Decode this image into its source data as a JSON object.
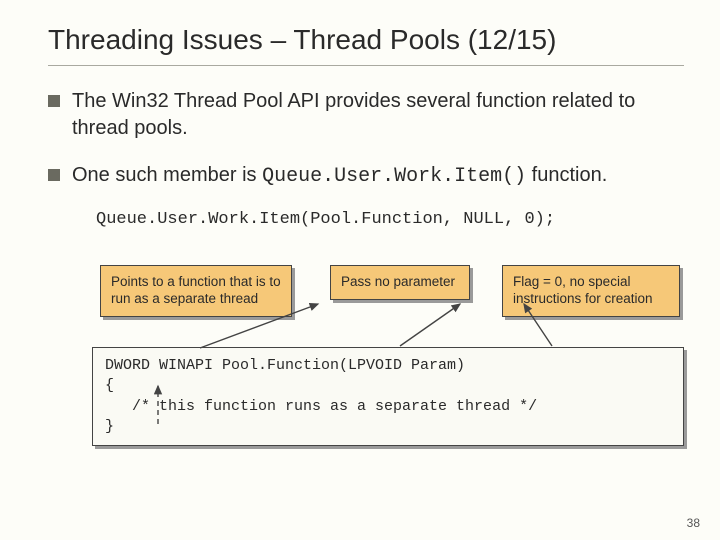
{
  "title": "Threading Issues – Thread Pools (12/15)",
  "bullets": [
    {
      "text_before": "The Win32 Thread Pool API provides several function related to thread pools.",
      "code": ""
    },
    {
      "text_before": "One such member is ",
      "code": "Queue.User.Work.Item()",
      "text_after": " function."
    }
  ],
  "codecall": "Queue.User.Work.Item(Pool.Function, NULL, 0);",
  "callouts": {
    "c1": "Points to a function that is to run as a separate thread",
    "c2": "Pass no parameter",
    "c3": "Flag = 0, no special instructions for creation"
  },
  "codebox_lines": [
    "DWORD WINAPI Pool.Function(LPVOID Param)",
    "{",
    "   /* this function runs as a separate thread */",
    "}"
  ],
  "page_number": "38"
}
